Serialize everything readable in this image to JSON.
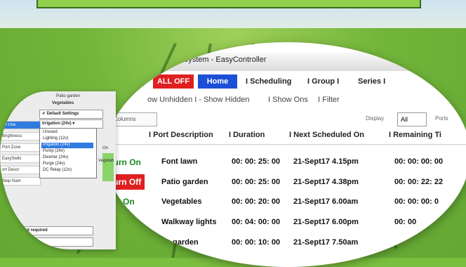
{
  "app": {
    "title": "ation System  -  EasyController"
  },
  "nav": {
    "all_off": "ALL OFF",
    "home": "Home",
    "items": [
      "I  Scheduling",
      "I  Group  I",
      "Series I"
    ]
  },
  "filters": {
    "items": [
      "ow Unhidden  I - Show Hidden",
      "I  Show Ons",
      "I  Filter"
    ],
    "show_columns": "how Columns",
    "display_label": "Display",
    "display_value": "All",
    "ports_label": "Ports"
  },
  "table": {
    "headers": [
      "I  Port Description",
      "I  Duration",
      "I  Next Scheduled On",
      "I  Remaining Ti"
    ],
    "rows": [
      {
        "button": "Turn On",
        "state": "on",
        "desc": "Font lawn",
        "duration": "00: 00: 25: 00",
        "next": "21-Sept17 4.15pm",
        "remaining": "00: 00: 00: 00"
      },
      {
        "button": "Turn Off",
        "state": "off",
        "desc": "Patio garden",
        "duration": "00: 00: 25: 00",
        "next": "21-Sept17 4.38pm",
        "remaining": "00: 00: 22: 22"
      },
      {
        "button": "n On",
        "state": "on",
        "desc": "Vegetables",
        "duration": "00: 00: 20: 00",
        "next": "21-Sept17 6.00am",
        "remaining": "00: 00: 00: 0"
      },
      {
        "button": "",
        "state": "none",
        "desc": "Walkway lights",
        "duration": "00: 04: 00: 00",
        "next": "21-Sept17 6.00pm",
        "remaining": "00: 00"
      },
      {
        "button": "",
        "state": "none",
        "desc": "garden",
        "duration": "00: 00: 10: 00",
        "next": "21-Sept17 7.50am",
        "remaining": ""
      }
    ]
  },
  "panel": {
    "top_labels": [
      "Patio garden",
      "Vegetables"
    ],
    "default_settings": "✔ Default Settings",
    "type_select": "Irrigation  (24v) ▾",
    "left_items": [
      "ort Use",
      "Brightness",
      "Port Zone",
      "EasySwitc",
      "ort Descr",
      "Step Nam"
    ],
    "dropdown": [
      "Unused",
      "Lighting   (12v)",
      "Irrigation (24v)",
      "Pump      (24v)",
      "Diverter  (24v)",
      "Purge       (24v)",
      "DC Relay  (12v)"
    ],
    "bottom_selects": [
      "Not required",
      "ied"
    ],
    "side_text": [
      "On",
      "Vegetab"
    ]
  }
}
